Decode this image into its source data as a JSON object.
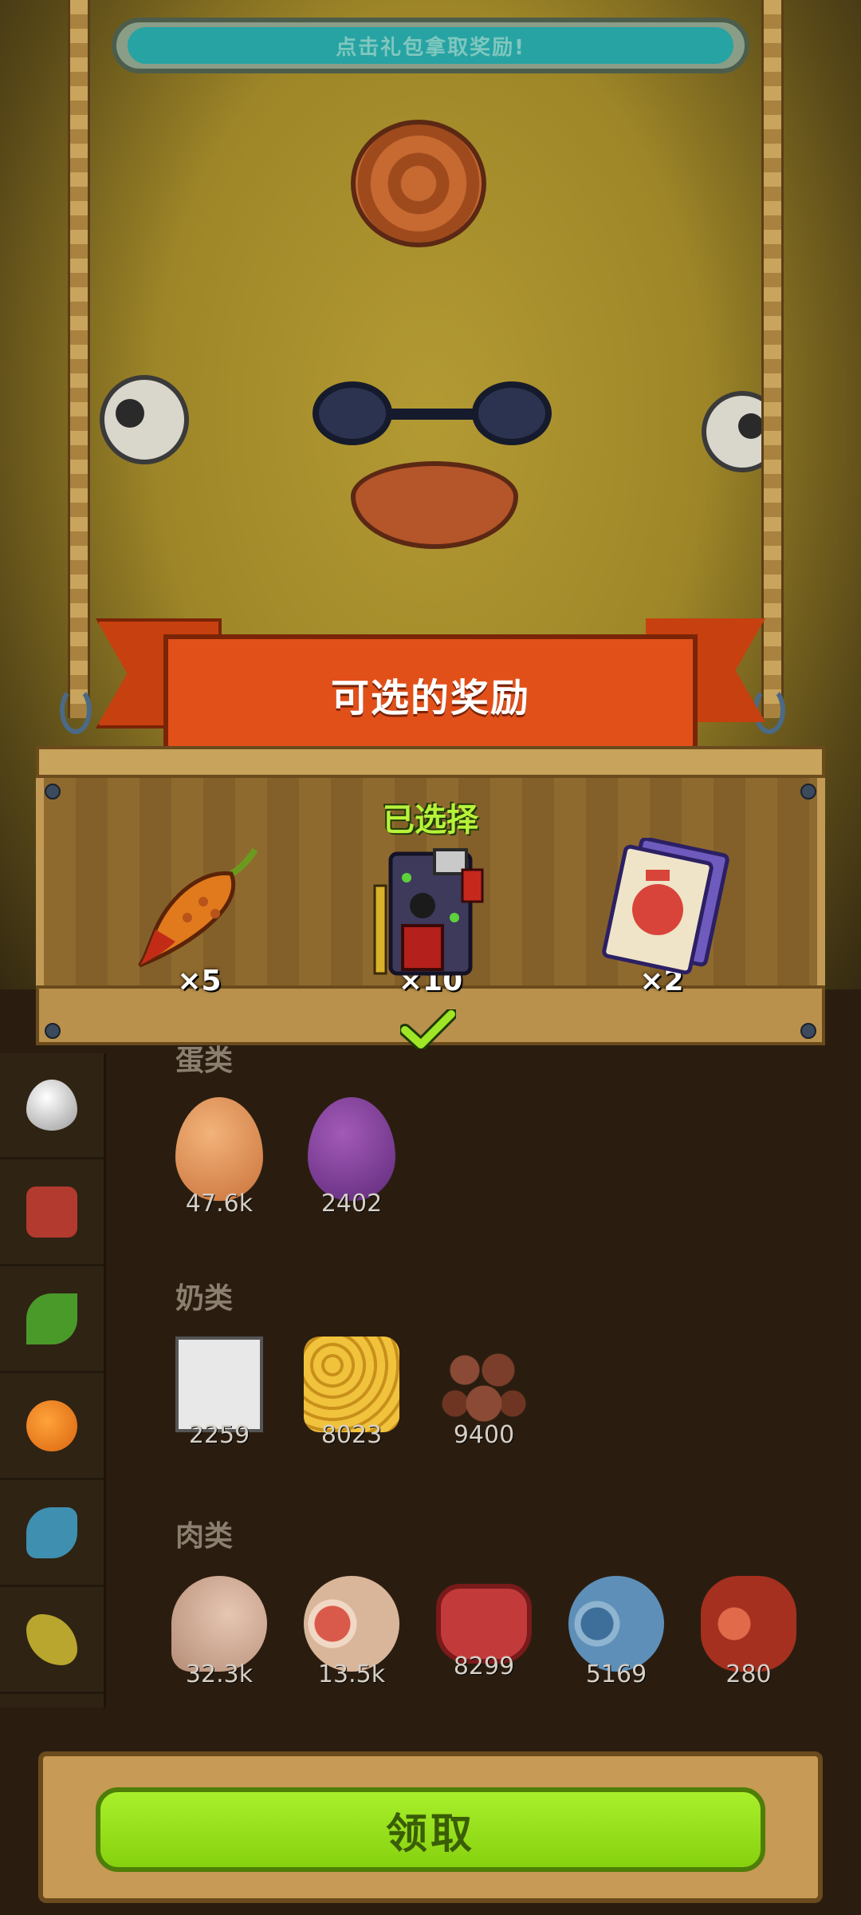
{
  "top_hint": {
    "text": "点击礼包拿取奖励!"
  },
  "reward_panel": {
    "title": "可选的奖励",
    "selected_label": "已选择",
    "rewards": [
      {
        "icon": "chili-pepper-icon",
        "count": "×5"
      },
      {
        "icon": "hero-gear-pack-icon",
        "count": "×10",
        "selected": true
      },
      {
        "icon": "scroll-card-icon",
        "count": "×2"
      }
    ]
  },
  "inventory": {
    "categories": [
      {
        "title": "蛋类",
        "items": [
          {
            "icon": "orange-egg-icon",
            "count": "47.6k"
          },
          {
            "icon": "purple-egg-icon",
            "count": "2402"
          }
        ]
      },
      {
        "title": "奶类",
        "items": [
          {
            "icon": "milk-carton-icon",
            "count": "2259"
          },
          {
            "icon": "honeycomb-icon",
            "count": "8023"
          },
          {
            "icon": "brown-balls-icon",
            "count": "9400"
          }
        ]
      },
      {
        "title": "肉类",
        "items": [
          {
            "icon": "drumstick-icon",
            "count": "32.3k"
          },
          {
            "icon": "ham-icon",
            "count": "13.5k"
          },
          {
            "icon": "steak-icon",
            "count": "8299"
          },
          {
            "icon": "blue-meat-icon",
            "count": "5169"
          },
          {
            "icon": "red-meat-roll-icon",
            "count": "280"
          }
        ]
      }
    ]
  },
  "side_tabs": [
    "water-drop-icon",
    "meat-icon",
    "leaf-icon",
    "orange-icon",
    "fish-icon",
    "wheat-icon"
  ],
  "claim_button": {
    "label": "领取"
  },
  "colors": {
    "accent_green": "#8fd416",
    "ribbon_orange": "#e2501a",
    "selected_green": "#b8f23a"
  }
}
